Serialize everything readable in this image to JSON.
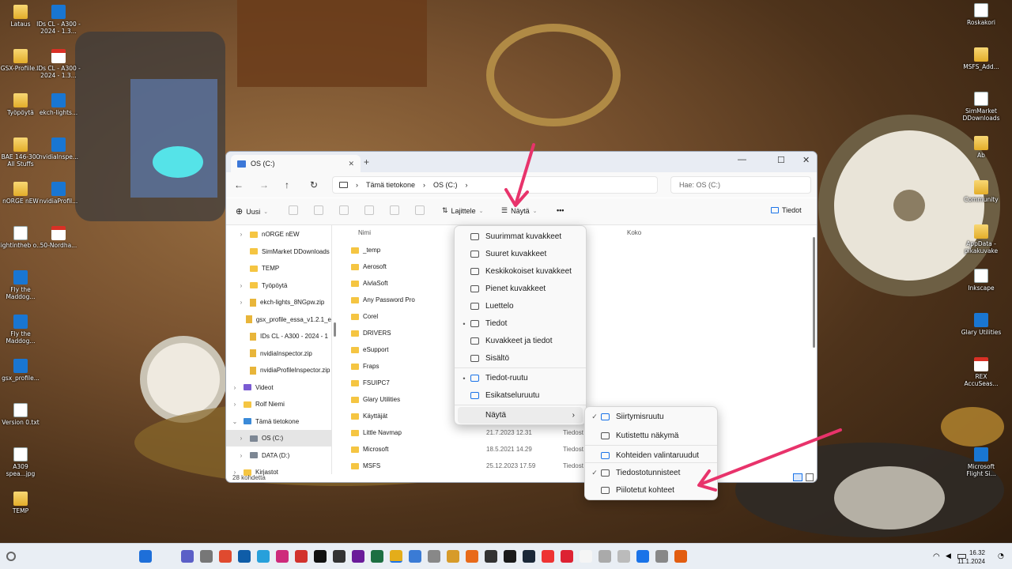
{
  "desktop": {
    "left_icons": [
      {
        "label": "Lataus",
        "kind": "folder"
      },
      {
        "label": "IDs CL - A300 - 2024 - 1.3...",
        "kind": "appsq"
      },
      {
        "label": "GSX-Profiile...",
        "kind": "folder"
      },
      {
        "label": "IDs CL - A300 - 2024 - 1.3...",
        "kind": "pdf"
      },
      {
        "label": "Työpöytä",
        "kind": "folder"
      },
      {
        "label": "ekch-lights...",
        "kind": "appsq"
      },
      {
        "label": "BAE 146-300 All Stuffs",
        "kind": "folder"
      },
      {
        "label": "nvidiaInspe...",
        "kind": "appsq"
      },
      {
        "label": "nORGE nEW",
        "kind": "folder"
      },
      {
        "label": "nvidiaProfil...",
        "kind": "appsq"
      },
      {
        "label": "lightintheb o...",
        "kind": "doc"
      },
      {
        "label": "50-Nordha...",
        "kind": "pdf"
      },
      {
        "label": "Fly the Maddog...",
        "kind": "appsq"
      },
      {
        "label": "Fly the Maddog...",
        "kind": "appsq"
      },
      {
        "label": "gsx_profile...",
        "kind": "appsq"
      },
      {
        "label": "Version 0.txt",
        "kind": "doc"
      },
      {
        "label": "A309 spea...jpg",
        "kind": "doc"
      },
      {
        "label": "TEMP",
        "kind": "folder"
      }
    ],
    "right_icons": [
      {
        "label": "Roskakori",
        "kind": "doc"
      },
      {
        "label": "MSFS_Add...",
        "kind": "folder"
      },
      {
        "label": "SimMarket DDownloads",
        "kind": "doc"
      },
      {
        "label": "Ab",
        "kind": "folder"
      },
      {
        "label": "Community",
        "kind": "folder"
      },
      {
        "label": "AppData - pikakuvake",
        "kind": "folder"
      },
      {
        "label": "Inkscape",
        "kind": "doc"
      },
      {
        "label": "Glary Utilities",
        "kind": "appsq"
      },
      {
        "label": "REX AccuSeas...",
        "kind": "pdf"
      },
      {
        "label": "Microsoft Flight Si...",
        "kind": "appsq"
      }
    ]
  },
  "explorer": {
    "tab_title": "OS (C:)",
    "new_tab": "+",
    "controls": {
      "min": "—",
      "max": "☐",
      "close": "✕"
    },
    "nav_buttons": {
      "back": "←",
      "forward": "→",
      "up": "↑",
      "refresh": "↻"
    },
    "breadcrumb": [
      "Tämä tietokone",
      "OS (C:)"
    ],
    "search_placeholder": "Hae: OS (C:)",
    "toolbar": {
      "new": "Uusi",
      "sort": "Lajittele",
      "view": "Näytä",
      "more": "•••",
      "details": "Tiedot"
    },
    "sidebar": [
      {
        "label": "nORGE nEW",
        "icon": "folder",
        "chevron": "›"
      },
      {
        "label": "SimMarket DDownloads",
        "icon": "folder",
        "chevron": ""
      },
      {
        "label": "TEMP",
        "icon": "folder",
        "chevron": ""
      },
      {
        "label": "Työpöytä",
        "icon": "folder",
        "chevron": "›"
      },
      {
        "label": "ekch-lights_8NGpw.zip",
        "icon": "zip",
        "chevron": "›"
      },
      {
        "label": "gsx_profile_essa_v1.2.1_e",
        "icon": "zip",
        "chevron": ""
      },
      {
        "label": "IDs CL - A300 - 2024 - 1",
        "icon": "zip",
        "chevron": ""
      },
      {
        "label": "nvidiaInspector.zip",
        "icon": "zip",
        "chevron": ""
      },
      {
        "label": "nvidiaProfileInspector.zip",
        "icon": "zip",
        "chevron": ""
      },
      {
        "label": "Videot",
        "icon": "video",
        "chevron": "›"
      },
      {
        "label": "Rolf Niemi",
        "icon": "folder",
        "chevron": "›"
      },
      {
        "label": "Tämä tietokone",
        "icon": "pc",
        "chevron": "⌄"
      },
      {
        "label": "OS (C:)",
        "icon": "drive",
        "chevron": "›",
        "selected": true
      },
      {
        "label": "DATA (D:)",
        "icon": "drive",
        "chevron": "›"
      },
      {
        "label": "Kirjastot",
        "icon": "folder",
        "chevron": "›"
      }
    ],
    "columns": {
      "name": "Nimi",
      "size": "Koko"
    },
    "files": [
      {
        "name": "_temp",
        "date": "",
        "type": "okansio"
      },
      {
        "name": "Aerosoft",
        "date": "",
        "type": "okansio"
      },
      {
        "name": "AivlaSoft",
        "date": "",
        "type": "okansio"
      },
      {
        "name": "Any Password Pro",
        "date": "",
        "type": "okansio"
      },
      {
        "name": "Corel",
        "date": "",
        "type": "okansio"
      },
      {
        "name": "DRIVERS",
        "date": "",
        "type": "okansio"
      },
      {
        "name": "eSupport",
        "date": "",
        "type": "okansio"
      },
      {
        "name": "Fraps",
        "date": "",
        "type": "okansio"
      },
      {
        "name": "FSUIPC7",
        "date": "",
        "type": "okansio"
      },
      {
        "name": "Glary Utilities",
        "date": "",
        "type": "okansio"
      },
      {
        "name": "Käyttäjät",
        "date": "",
        "type": "okansio"
      },
      {
        "name": "Little Navmap",
        "date": "21.7.2023 12.31",
        "type": "Tiedost"
      },
      {
        "name": "Microsoft",
        "date": "18.5.2021 14.29",
        "type": "Tiedost"
      },
      {
        "name": "MSFS",
        "date": "25.12.2023 17.59",
        "type": "Tiedost"
      }
    ],
    "status": "28 kohdetta"
  },
  "view_menu": {
    "items": [
      {
        "label": "Suurimmat kuvakkeet",
        "check": ""
      },
      {
        "label": "Suuret kuvakkeet",
        "check": ""
      },
      {
        "label": "Keskikokoiset kuvakkeet",
        "check": ""
      },
      {
        "label": "Pienet kuvakkeet",
        "check": ""
      },
      {
        "label": "Luettelo",
        "check": ""
      },
      {
        "label": "Tiedot",
        "check": "•"
      },
      {
        "label": "Kuvakkeet ja tiedot",
        "check": ""
      },
      {
        "label": "Sisältö",
        "check": ""
      },
      {
        "label": "Tiedot-ruutu",
        "check": "•"
      },
      {
        "label": "Esikatseluruutu",
        "check": ""
      },
      {
        "label": "Näytä",
        "check": "",
        "submenu": "›"
      }
    ]
  },
  "show_submenu": {
    "items": [
      {
        "label": "Siirtymisruutu",
        "check": "✓"
      },
      {
        "label": "Kutistettu näkymä",
        "check": ""
      },
      {
        "label": "Kohteiden valintaruudut",
        "check": ""
      },
      {
        "label": "Tiedostotunnisteet",
        "check": "✓"
      },
      {
        "label": "Piilotetut kohteet",
        "check": ""
      }
    ]
  },
  "taskbar": {
    "time": "16.32",
    "date": "11.1.2024"
  },
  "colors": {
    "accent": "#1a73e8",
    "arrow": "#e8336b",
    "folder": "#f5c542"
  }
}
